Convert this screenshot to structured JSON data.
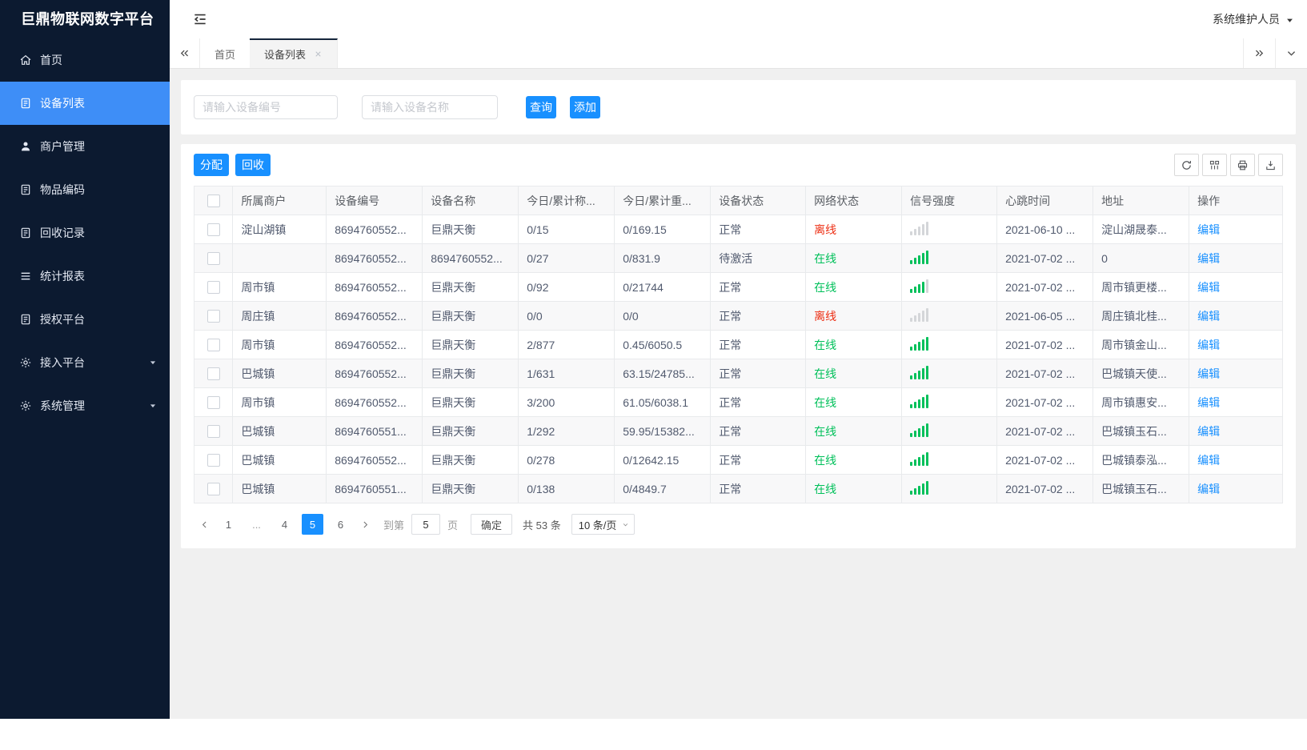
{
  "app": {
    "title": "巨鼎物联网数字平台",
    "user_menu": "系统维护人员"
  },
  "sidebar": {
    "items": [
      {
        "key": "home",
        "label": "首页",
        "icon": "home-icon",
        "active": false,
        "caret": false
      },
      {
        "key": "device-list",
        "label": "设备列表",
        "icon": "doc-icon",
        "active": true,
        "caret": false
      },
      {
        "key": "merchant-management",
        "label": "商户管理",
        "icon": "user-icon",
        "active": false,
        "caret": false
      },
      {
        "key": "item-coding",
        "label": "物品编码",
        "icon": "doc-icon",
        "active": false,
        "caret": false
      },
      {
        "key": "recycle-records",
        "label": "回收记录",
        "icon": "doc-icon",
        "active": false,
        "caret": false
      },
      {
        "key": "statistics-report",
        "label": "统计报表",
        "icon": "list-icon",
        "active": false,
        "caret": false
      },
      {
        "key": "authorization-platform",
        "label": "授权平台",
        "icon": "doc-icon",
        "active": false,
        "caret": false
      },
      {
        "key": "access-platform",
        "label": "接入平台",
        "icon": "gear-icon",
        "active": false,
        "caret": true
      },
      {
        "key": "system-management",
        "label": "系统管理",
        "icon": "gear-icon",
        "active": false,
        "caret": true
      }
    ]
  },
  "tabs": {
    "items": [
      {
        "key": "home",
        "label": "首页",
        "active": false,
        "closable": false
      },
      {
        "key": "device-list",
        "label": "设备列表",
        "active": true,
        "closable": true
      }
    ]
  },
  "search": {
    "device_no_placeholder": "请输入设备编号",
    "device_name_placeholder": "请输入设备名称",
    "query_label": "查询",
    "add_label": "添加"
  },
  "toolbar": {
    "assign_label": "分配",
    "recycle_label": "回收",
    "icon_buttons": [
      "refresh-icon",
      "columns-icon",
      "print-icon",
      "export-icon"
    ]
  },
  "table": {
    "columns": [
      "所属商户",
      "设备编号",
      "设备名称",
      "今日/累计称...",
      "今日/累计重...",
      "设备状态",
      "网络状态",
      "信号强度",
      "心跳时间",
      "地址",
      "操作"
    ],
    "edit_label": "编辑",
    "rows": [
      {
        "merchant": "淀山湖镇",
        "device_no": "8694760552...",
        "device_name": "巨鼎天衡",
        "today_count": "0/15",
        "today_weight": "0/169.15",
        "device_status": "正常",
        "network_status": "离线",
        "signal_level": 0,
        "heartbeat": "2021-06-10 ...",
        "address": "淀山湖晟泰..."
      },
      {
        "merchant": "",
        "device_no": "8694760552...",
        "device_name": "8694760552...",
        "today_count": "0/27",
        "today_weight": "0/831.9",
        "device_status": "待激活",
        "network_status": "在线",
        "signal_level": 5,
        "heartbeat": "2021-07-02 ...",
        "address": "0"
      },
      {
        "merchant": "周市镇",
        "device_no": "8694760552...",
        "device_name": "巨鼎天衡",
        "today_count": "0/92",
        "today_weight": "0/21744",
        "device_status": "正常",
        "network_status": "在线",
        "signal_level": 4,
        "heartbeat": "2021-07-02 ...",
        "address": "周市镇更楼..."
      },
      {
        "merchant": "周庄镇",
        "device_no": "8694760552...",
        "device_name": "巨鼎天衡",
        "today_count": "0/0",
        "today_weight": "0/0",
        "device_status": "正常",
        "network_status": "离线",
        "signal_level": 0,
        "heartbeat": "2021-06-05 ...",
        "address": "周庄镇北桂..."
      },
      {
        "merchant": "周市镇",
        "device_no": "8694760552...",
        "device_name": "巨鼎天衡",
        "today_count": "2/877",
        "today_weight": "0.45/6050.5",
        "device_status": "正常",
        "network_status": "在线",
        "signal_level": 5,
        "heartbeat": "2021-07-02 ...",
        "address": "周市镇金山..."
      },
      {
        "merchant": "巴城镇",
        "device_no": "8694760552...",
        "device_name": "巨鼎天衡",
        "today_count": "1/631",
        "today_weight": "63.15/24785...",
        "device_status": "正常",
        "network_status": "在线",
        "signal_level": 5,
        "heartbeat": "2021-07-02 ...",
        "address": "巴城镇天使..."
      },
      {
        "merchant": "周市镇",
        "device_no": "8694760552...",
        "device_name": "巨鼎天衡",
        "today_count": "3/200",
        "today_weight": "61.05/6038.1",
        "device_status": "正常",
        "network_status": "在线",
        "signal_level": 5,
        "heartbeat": "2021-07-02 ...",
        "address": "周市镇惠安..."
      },
      {
        "merchant": "巴城镇",
        "device_no": "8694760551...",
        "device_name": "巨鼎天衡",
        "today_count": "1/292",
        "today_weight": "59.95/15382...",
        "device_status": "正常",
        "network_status": "在线",
        "signal_level": 5,
        "heartbeat": "2021-07-02 ...",
        "address": "巴城镇玉石..."
      },
      {
        "merchant": "巴城镇",
        "device_no": "8694760552...",
        "device_name": "巨鼎天衡",
        "today_count": "0/278",
        "today_weight": "0/12642.15",
        "device_status": "正常",
        "network_status": "在线",
        "signal_level": 5,
        "heartbeat": "2021-07-02 ...",
        "address": "巴城镇泰泓..."
      },
      {
        "merchant": "巴城镇",
        "device_no": "8694760551...",
        "device_name": "巨鼎天衡",
        "today_count": "0/138",
        "today_weight": "0/4849.7",
        "device_status": "正常",
        "network_status": "在线",
        "signal_level": 5,
        "heartbeat": "2021-07-02 ...",
        "address": "巴城镇玉石..."
      }
    ]
  },
  "pagination": {
    "pages": [
      "1",
      "...",
      "4",
      "5",
      "6"
    ],
    "active_page": "5",
    "jump_prefix": "到第",
    "jump_value": "5",
    "jump_suffix": "页",
    "confirm_label": "确定",
    "total_label": "共 53 条",
    "page_size_label": "10 条/页"
  },
  "colors": {
    "primary": "#1890ff",
    "sidebar_bg": "#0c1a30",
    "sidebar_active": "#3e8ef7",
    "online_green": "#00c05a",
    "offline_red": "#ed2f14"
  }
}
